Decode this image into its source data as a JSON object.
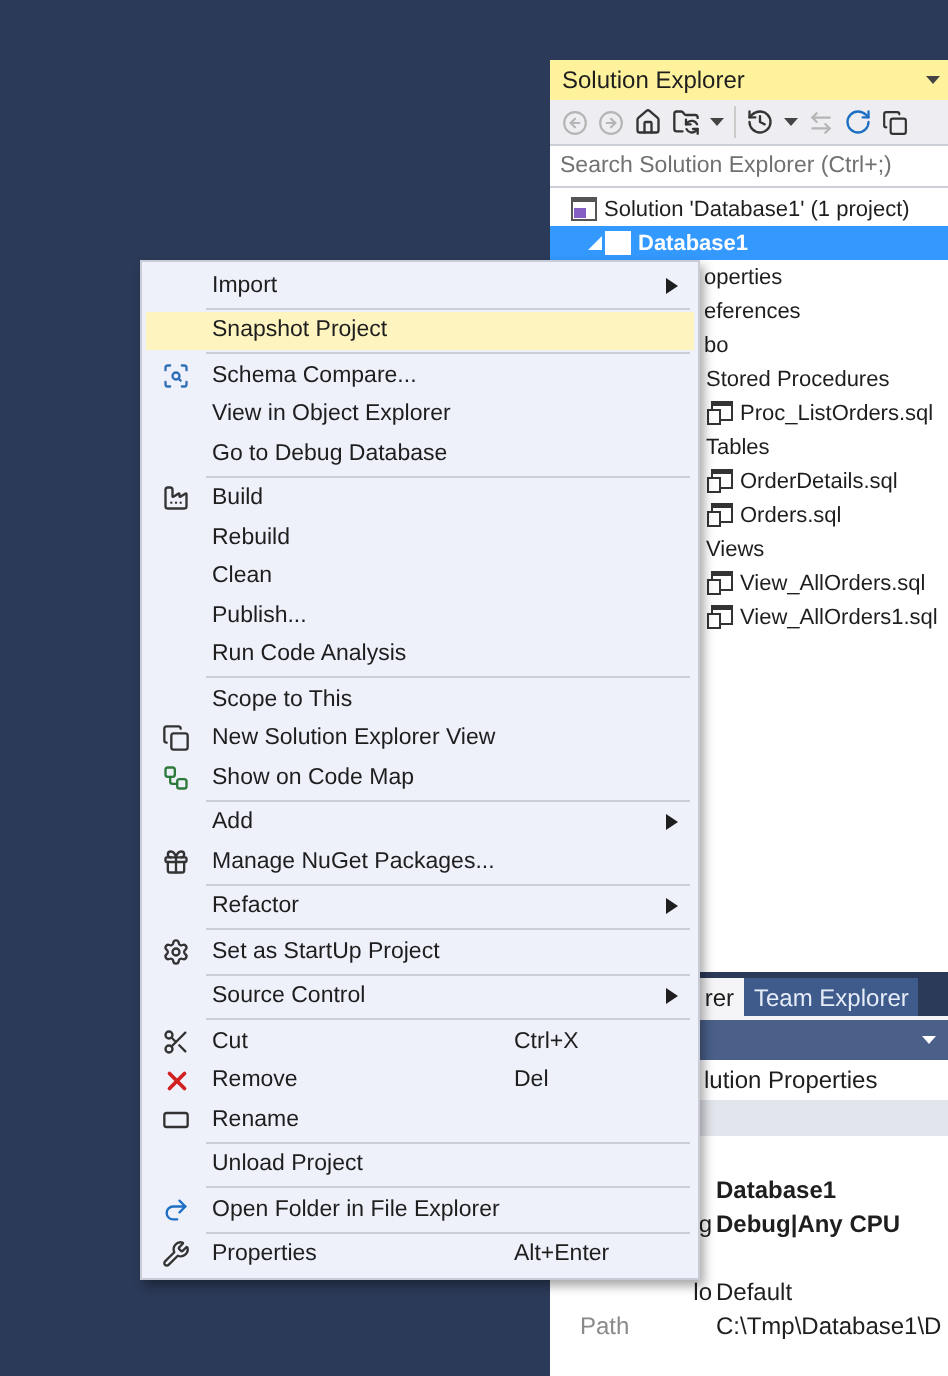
{
  "solution_explorer": {
    "title": "Solution Explorer",
    "search": {
      "placeholder": "Search Solution Explorer (Ctrl+;)"
    },
    "tree": [
      {
        "label": "Solution 'Database1' (1 project)",
        "kind": "solution",
        "selected": false,
        "children": [
          {
            "label": "Database1",
            "kind": "project",
            "selected": true,
            "expanded": true,
            "children": [
              {
                "label": "operties",
                "kind": "partial",
                "selected": false
              },
              {
                "label": "eferences",
                "kind": "partial",
                "selected": false
              },
              {
                "label": "bo",
                "kind": "partial",
                "selected": false,
                "children": [
                  {
                    "label": "Stored Procedures",
                    "selected": false,
                    "children": [
                      {
                        "label": "Proc_ListOrders.sql",
                        "kind": "file",
                        "selected": false
                      }
                    ]
                  },
                  {
                    "label": "Tables",
                    "selected": false,
                    "children": [
                      {
                        "label": "OrderDetails.sql",
                        "kind": "file",
                        "selected": false
                      },
                      {
                        "label": "Orders.sql",
                        "kind": "file",
                        "selected": false
                      }
                    ]
                  },
                  {
                    "label": "Views",
                    "selected": false,
                    "children": [
                      {
                        "label": "View_AllOrders.sql",
                        "kind": "file",
                        "selected": false
                      },
                      {
                        "label": "View_AllOrders1.sql",
                        "kind": "file",
                        "selected": false
                      }
                    ]
                  }
                ]
              }
            ]
          }
        ]
      }
    ]
  },
  "tool_tabs": [
    {
      "label": "rer",
      "selected": true
    },
    {
      "label": "Team Explorer",
      "selected": false
    }
  ],
  "properties": {
    "object": "lution Properties",
    "rows": [
      {
        "kind": "partial",
        "value": "Database1",
        "bold": true
      },
      {
        "kind": "partial",
        "name": "g",
        "value": "Debug|Any CPU",
        "bold": true
      },
      {
        "kind": "blank"
      },
      {
        "kind": "partial",
        "name": "lo",
        "value": "Default",
        "bold": false
      },
      {
        "kind": "property",
        "name": "Path",
        "value": "C:\\Tmp\\Database1\\D",
        "bold": false
      }
    ]
  },
  "context_menu": {
    "groups": [
      [
        {
          "label": "Import",
          "has_submenu": true,
          "selected": false
        }
      ],
      [
        {
          "label": "Snapshot Project",
          "has_submenu": false,
          "selected": true
        }
      ],
      [
        {
          "label": "Schema Compare...",
          "has_submenu": false,
          "selected": false
        },
        {
          "label": "View in Object Explorer",
          "has_submenu": false,
          "selected": false
        },
        {
          "label": "Go to Debug Database",
          "has_submenu": false,
          "selected": false
        }
      ],
      [
        {
          "label": "Build",
          "has_submenu": false,
          "selected": false
        },
        {
          "label": "Rebuild",
          "has_submenu": false,
          "selected": false
        },
        {
          "label": "Clean",
          "has_submenu": false,
          "selected": false
        },
        {
          "label": "Publish...",
          "has_submenu": false,
          "selected": false
        },
        {
          "label": "Run Code Analysis",
          "has_submenu": false,
          "selected": false
        }
      ],
      [
        {
          "label": "Scope to This",
          "has_submenu": false,
          "selected": false
        },
        {
          "label": "New Solution Explorer View",
          "has_submenu": false,
          "selected": false
        },
        {
          "label": "Show on Code Map",
          "has_submenu": false,
          "selected": false
        }
      ],
      [
        {
          "label": "Add",
          "has_submenu": true,
          "selected": false
        },
        {
          "label": "Manage NuGet Packages...",
          "has_submenu": false,
          "selected": false
        }
      ],
      [
        {
          "label": "Refactor",
          "has_submenu": true,
          "selected": false
        }
      ],
      [
        {
          "label": "Set as StartUp Project",
          "has_submenu": false,
          "selected": false
        }
      ],
      [
        {
          "label": "Source Control",
          "has_submenu": true,
          "selected": false
        }
      ],
      [
        {
          "label": "Cut",
          "shortcut": "Ctrl+X",
          "has_submenu": false,
          "selected": false
        },
        {
          "label": "Remove",
          "shortcut": "Del",
          "has_submenu": false,
          "selected": false
        },
        {
          "label": "Rename",
          "has_submenu": false,
          "selected": false
        }
      ],
      [
        {
          "label": "Unload Project",
          "has_submenu": false,
          "selected": false
        }
      ],
      [
        {
          "label": "Open Folder in File Explorer",
          "has_submenu": false,
          "selected": false
        }
      ],
      [
        {
          "label": "Properties",
          "shortcut": "Alt+Enter",
          "has_submenu": false,
          "selected": false
        }
      ]
    ]
  }
}
